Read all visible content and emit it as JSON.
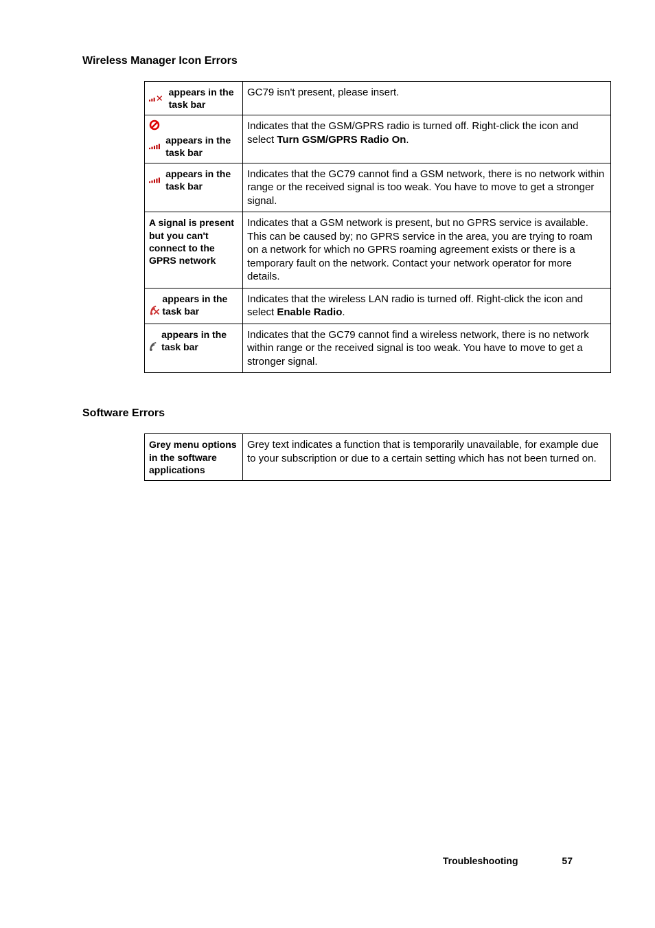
{
  "headings": {
    "h1": "Wireless Manager Icon Errors",
    "h2": "Software Errors"
  },
  "table1": {
    "rows": [
      {
        "label_suffix": " appears in the task bar",
        "desc": "GC79 isn't present, please insert."
      },
      {
        "label_suffix": " appears in the task bar",
        "desc_pre": "Indicates that the GSM/GPRS radio is turned off. Right-click the icon and select ",
        "desc_bold": "Turn GSM/GPRS Radio On",
        "desc_post": "."
      },
      {
        "label_suffix": " appears in the task bar",
        "desc": "Indicates that the GC79 cannot find a GSM network, there is no network within range or the received signal is too weak. You have to move to get a stronger signal."
      },
      {
        "label_full": "A signal is present but you can't connect to the GPRS network",
        "desc": "Indicates that a GSM network is present, but no GPRS service is available. This can be caused by; no GPRS service in the area, you are trying to roam on a network for which no GPRS roaming agreement exists or there is a temporary fault on the network. Contact your network operator for more details."
      },
      {
        "label_suffix": " appears in the task bar",
        "desc_pre": "Indicates that the wireless LAN radio is turned off. Right-click the icon and select ",
        "desc_bold": "Enable Radio",
        "desc_post": "."
      },
      {
        "label_suffix": " appears in the task bar",
        "desc": "Indicates that the GC79 cannot find a wireless network, there is no network within range or the received signal is too weak. You have to move to get a stronger signal."
      }
    ]
  },
  "table2": {
    "rows": [
      {
        "label_full": "Grey menu options in the software applications",
        "desc": "Grey text indicates a function that is temporarily unavailable, for example due to your subscription or due to a certain setting which has not been turned on."
      }
    ]
  },
  "footer": {
    "title": "Troubleshooting",
    "page": "57"
  }
}
